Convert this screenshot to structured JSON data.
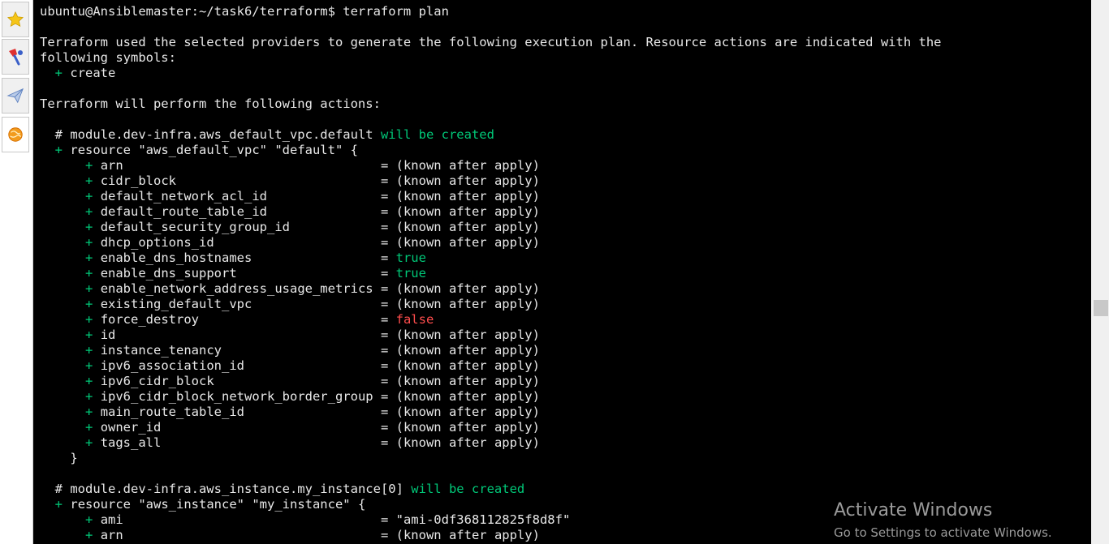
{
  "colors": {
    "background": "#000000",
    "text": "#e8e8e8",
    "green": "#00c878",
    "red": "#ff4d4d",
    "watermark": "#9a9a9a"
  },
  "sidebar": {
    "items": [
      {
        "icon": "star-icon"
      },
      {
        "icon": "pin-icon"
      },
      {
        "icon": "paper-plane-icon"
      },
      {
        "icon": "globe-icon"
      }
    ]
  },
  "terminal": {
    "prompt": "ubuntu@Ansiblemaster:~/task6/terraform$ terraform plan",
    "intro_line1": "Terraform used the selected providers to generate the following execution plan. Resource actions are indicated with the",
    "intro_line2": "following symbols:",
    "create_symbol": "+",
    "create_label": "create",
    "perform": "Terraform will perform the following actions:",
    "vpc": {
      "comment": "# module.dev-infra.aws_default_vpc.default",
      "status": "will be created",
      "resource_line": "resource \"aws_default_vpc\" \"default\" {",
      "attrs": [
        {
          "k": "arn                                 ",
          "v": "(known after apply)"
        },
        {
          "k": "cidr_block                          ",
          "v": "(known after apply)"
        },
        {
          "k": "default_network_acl_id              ",
          "v": "(known after apply)"
        },
        {
          "k": "default_route_table_id              ",
          "v": "(known after apply)"
        },
        {
          "k": "default_security_group_id           ",
          "v": "(known after apply)"
        },
        {
          "k": "dhcp_options_id                     ",
          "v": "(known after apply)"
        },
        {
          "k": "enable_dns_hostnames                ",
          "v": "true"
        },
        {
          "k": "enable_dns_support                  ",
          "v": "true"
        },
        {
          "k": "enable_network_address_usage_metrics",
          "v": "(known after apply)"
        },
        {
          "k": "existing_default_vpc                ",
          "v": "(known after apply)"
        },
        {
          "k": "force_destroy                       ",
          "v": "false"
        },
        {
          "k": "id                                  ",
          "v": "(known after apply)"
        },
        {
          "k": "instance_tenancy                    ",
          "v": "(known after apply)"
        },
        {
          "k": "ipv6_association_id                 ",
          "v": "(known after apply)"
        },
        {
          "k": "ipv6_cidr_block                     ",
          "v": "(known after apply)"
        },
        {
          "k": "ipv6_cidr_block_network_border_group",
          "v": "(known after apply)"
        },
        {
          "k": "main_route_table_id                 ",
          "v": "(known after apply)"
        },
        {
          "k": "owner_id                            ",
          "v": "(known after apply)"
        },
        {
          "k": "tags_all                            ",
          "v": "(known after apply)"
        }
      ],
      "close": "}"
    },
    "instance": {
      "comment": "# module.dev-infra.aws_instance.my_instance[0]",
      "status": "will be created",
      "resource_line": "resource \"aws_instance\" \"my_instance\" {",
      "attrs": [
        {
          "k": "ami                                 ",
          "v": "\"ami-0df368112825f8d8f\""
        },
        {
          "k": "arn                                 ",
          "v": "(known after apply)"
        }
      ]
    }
  },
  "watermark": {
    "title": "Activate Windows",
    "subtitle": "Go to Settings to activate Windows."
  }
}
